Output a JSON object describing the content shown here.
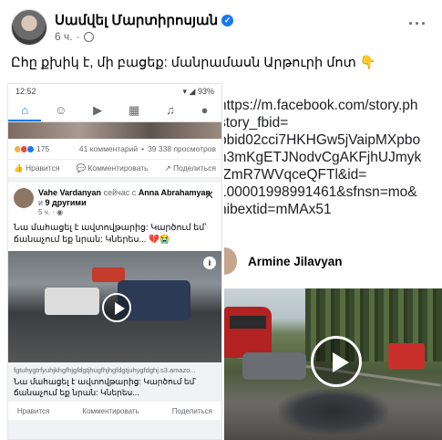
{
  "post": {
    "author": "Սամվել Մարտիրոսյան",
    "time": "6 ч.",
    "caption": "Ըհը քխիկ է, մի բացեք: մանրամասն Արթուրի մոտ 👇"
  },
  "phone": {
    "status_time": "12:52",
    "status_battery": "93%",
    "nav_icons": [
      "home-icon",
      "friends-icon",
      "video-icon",
      "marketplace-icon",
      "bell-icon",
      "menu-avatar-icon"
    ],
    "reaction_count": "175",
    "comments": "41 комментарий",
    "views": "39 338 просмотров",
    "actions": [
      "Нравится",
      "Комментировать",
      "Поделиться"
    ],
    "card": {
      "name": "Vahe Vardanyan",
      "with_text": "сейчас с",
      "tagged": "Anna Abrahamyan",
      "and_text": "и",
      "others": "9 другими",
      "time": "5 ч.",
      "text": "Նա մահացել է ավտովթարից: Կարծում եմ՝ ճանաչում եք նրան: Կներես... 💔😭",
      "link_url": "fgtuhygtrfyuhjkhgfhjgfdgtjhugfhjhgfdgtjuhygfdghj.s3.amazo...",
      "link_title": "Նա մահացել է ավտովթարից: Կարծում եմ՝ ճանաչում եք նրան: Կներես...",
      "actions": [
        "Нравится",
        "Комментировать",
        "Поделиться"
      ]
    }
  },
  "right": {
    "url_lines": [
      "https://m.facebook.com/story.ph",
      "story_fbid=",
      "pbid02cci7HKHGw5jVaipMXpbo",
      "n3mKgETJNodvCgAKFjhUJmyk",
      "fZmR7WVqceQFTl&id=",
      "100001998991461&sfnsn=mo&",
      "nibextid=mMAx51"
    ],
    "profile_name": "Armine Jilavyan"
  },
  "colors": {
    "accent": "#1877f2",
    "secondary_text": "#65676b"
  }
}
